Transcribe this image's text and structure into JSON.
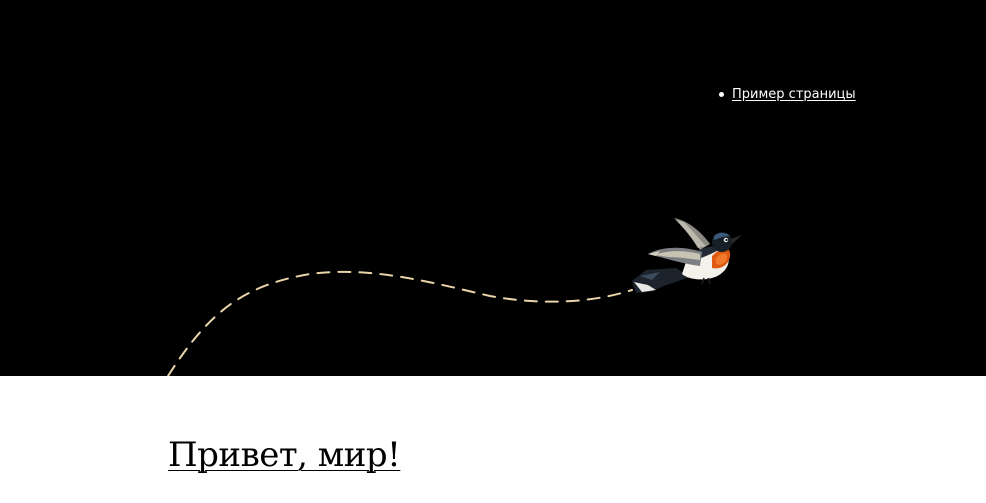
{
  "header": {
    "background_color": "#000000",
    "nav": {
      "items": [
        {
          "label": "Пример страницы"
        }
      ]
    },
    "illustration": {
      "subject": "bird-icon",
      "path_color": "#e9d3a8"
    }
  },
  "main": {
    "posts": [
      {
        "title": "Привет, мир!"
      }
    ]
  }
}
